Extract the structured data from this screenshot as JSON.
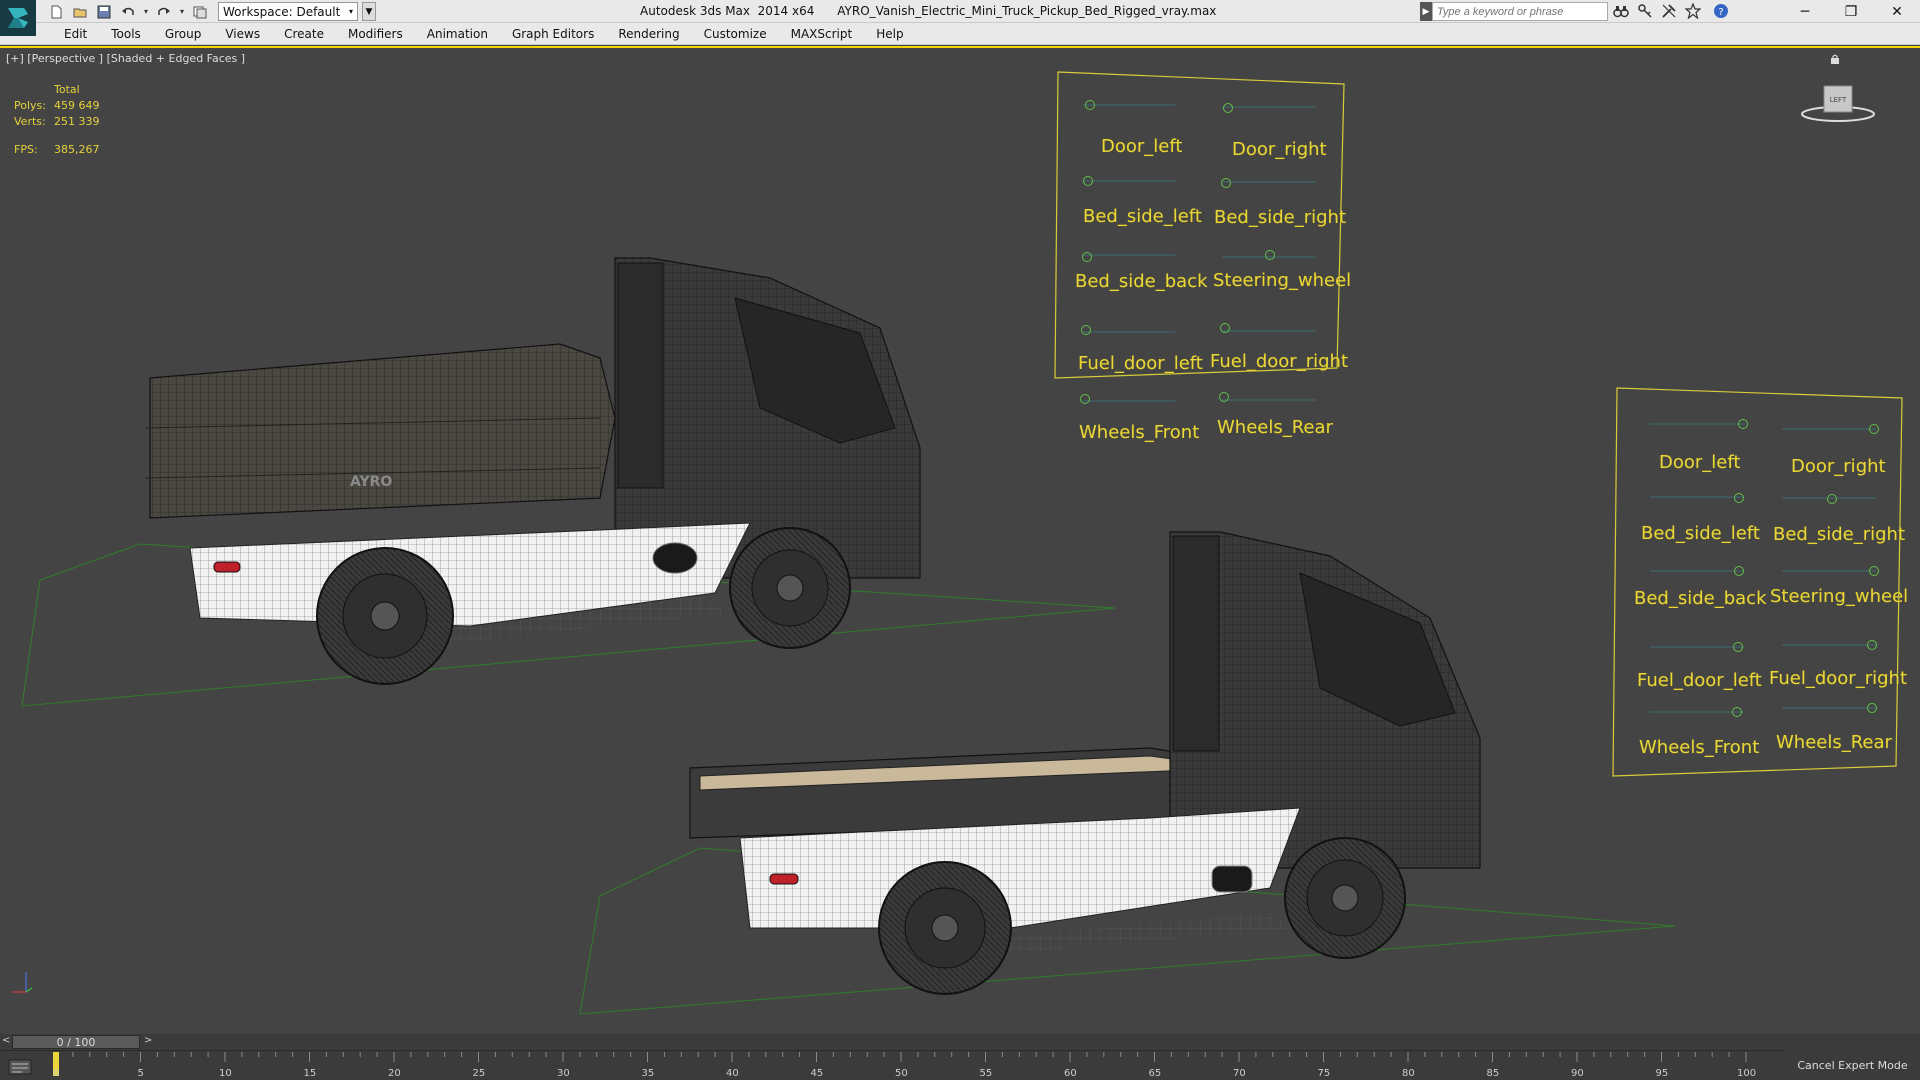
{
  "titlebar": {
    "workspace_label": "Workspace: Default",
    "app_title": "Autodesk 3ds Max  2014 x64      AYRO_Vanish_Electric_Mini_Truck_Pickup_Bed_Rigged_vray.max",
    "search_placeholder": "Type a keyword or phrase",
    "icons": [
      "new-file-icon",
      "open-file-icon",
      "save-icon",
      "undo-icon",
      "redo-icon",
      "project-icon",
      "binoculars-icon",
      "key-icon",
      "tools-icon",
      "star-icon",
      "help-icon"
    ]
  },
  "menubar": {
    "items": [
      "Edit",
      "Tools",
      "Group",
      "Views",
      "Create",
      "Modifiers",
      "Animation",
      "Graph Editors",
      "Rendering",
      "Customize",
      "MAXScript",
      "Help"
    ]
  },
  "viewport": {
    "label": "[+] [Perspective ] [Shaded + Edged Faces ]",
    "stats": {
      "total_label": "Total",
      "polys_label": "Polys:",
      "polys_value": "459 649",
      "verts_label": "Verts:",
      "verts_value": "251 339",
      "fps_label": "FPS:",
      "fps_value": "385,267"
    },
    "viewcube_label": "LEFT",
    "truck_logo": "AYRO"
  },
  "rig_panel_top": {
    "labels": [
      "Door_left",
      "Door_right",
      "Bed_side_left",
      "Bed_side_right",
      "Bed_side_back",
      "Steering_wheel",
      "Fuel_door_left",
      "Fuel_door_right",
      "Wheels_Front",
      "Wheels_Rear"
    ]
  },
  "rig_panel_right": {
    "labels": [
      "Door_left",
      "Door_right",
      "Bed_side_left",
      "Bed_side_right",
      "Bed_side_back",
      "Steering_wheel",
      "Fuel_door_left",
      "Fuel_door_right",
      "Wheels_Front",
      "Wheels_Rear"
    ]
  },
  "timeline": {
    "frame": "0 / 100",
    "prev": "<",
    "next": ">",
    "ticks": [
      "0",
      "5",
      "10",
      "15",
      "20",
      "25",
      "30",
      "35",
      "40",
      "45",
      "50",
      "55",
      "60",
      "65",
      "70",
      "75",
      "80",
      "85",
      "90",
      "95",
      "100"
    ],
    "cancel_expert": "Cancel Expert Mode"
  },
  "colors": {
    "accent_yellow": "#e8d63a",
    "knob_green": "#5fc14a",
    "viewport_bg": "#444444",
    "ground_line": "#3c8a30"
  }
}
